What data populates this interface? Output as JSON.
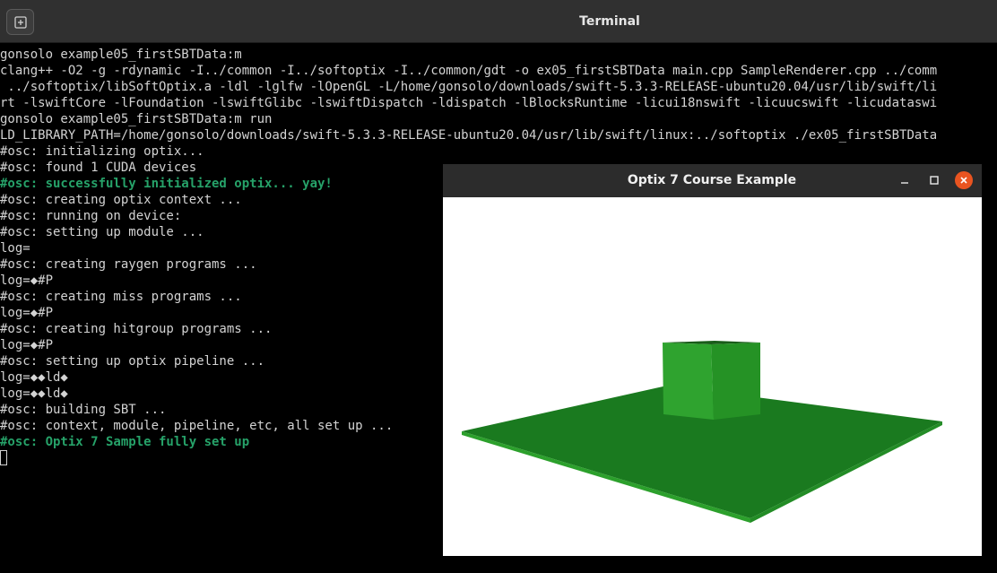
{
  "terminal_window": {
    "title": "Terminal",
    "new_tab_icon": "new-tab-icon"
  },
  "terminal": {
    "lines": [
      {
        "text": "gonsolo example05_firstSBTData:m",
        "green": false
      },
      {
        "text": "clang++ -O2 -g -rdynamic -I../common -I../softoptix -I../common/gdt -o ex05_firstSBTData main.cpp SampleRenderer.cpp ../comm",
        "green": false
      },
      {
        "text": " ../softoptix/libSoftOptix.a -ldl -lglfw -lOpenGL -L/home/gonsolo/downloads/swift-5.3.3-RELEASE-ubuntu20.04/usr/lib/swift/li",
        "green": false
      },
      {
        "text": "rt -lswiftCore -lFoundation -lswiftGlibc -lswiftDispatch -ldispatch -lBlocksRuntime -licui18nswift -licuucswift -licudataswi",
        "green": false
      },
      {
        "text": "gonsolo example05_firstSBTData:m run",
        "green": false
      },
      {
        "text": "LD_LIBRARY_PATH=/home/gonsolo/downloads/swift-5.3.3-RELEASE-ubuntu20.04/usr/lib/swift/linux:../softoptix ./ex05_firstSBTData",
        "green": false
      },
      {
        "text": "#osc: initializing optix...",
        "green": false
      },
      {
        "text": "#osc: found 1 CUDA devices",
        "green": false
      },
      {
        "text": "#osc: successfully initialized optix... yay!",
        "green": true
      },
      {
        "text": "#osc: creating optix context ...",
        "green": false
      },
      {
        "text": "#osc: running on device:",
        "green": false
      },
      {
        "text": "#osc: setting up module ...",
        "green": false
      },
      {
        "text": "log=",
        "green": false
      },
      {
        "text": "#osc: creating raygen programs ...",
        "green": false
      },
      {
        "text": "log=◆#P",
        "green": false
      },
      {
        "text": "#osc: creating miss programs ...",
        "green": false
      },
      {
        "text": "log=◆#P",
        "green": false
      },
      {
        "text": "#osc: creating hitgroup programs ...",
        "green": false
      },
      {
        "text": "log=◆#P",
        "green": false
      },
      {
        "text": "#osc: setting up optix pipeline ...",
        "green": false
      },
      {
        "text": "log=◆◆ld◆",
        "green": false
      },
      {
        "text": "log=◆◆ld◆",
        "green": false
      },
      {
        "text": "#osc: building SBT ...",
        "green": false
      },
      {
        "text": "#osc: context, module, pipeline, etc, all set up ...",
        "green": false
      },
      {
        "text": "#osc: Optix 7 Sample fully set up",
        "green": true
      }
    ]
  },
  "optix_window": {
    "title": "Optix 7 Course Example",
    "minimize_icon": "minimize-icon",
    "maximize_icon": "maximize-icon",
    "close_icon": "close-icon"
  },
  "scene": {
    "objects": [
      "ground-plane",
      "green-cube"
    ],
    "colors": {
      "background": "#ffffff",
      "plane_top": "#1a7a1f",
      "plane_edge": "#2ca02c",
      "cube_front": "#2fa32f",
      "cube_side": "#259225",
      "cube_top": "#1a5c1a"
    }
  },
  "colors": {
    "terminal_bg": "#000000",
    "terminal_text": "#d3d3d3",
    "success_green": "#26a269",
    "titlebar_bg": "#303030",
    "close_button": "#e95420"
  }
}
